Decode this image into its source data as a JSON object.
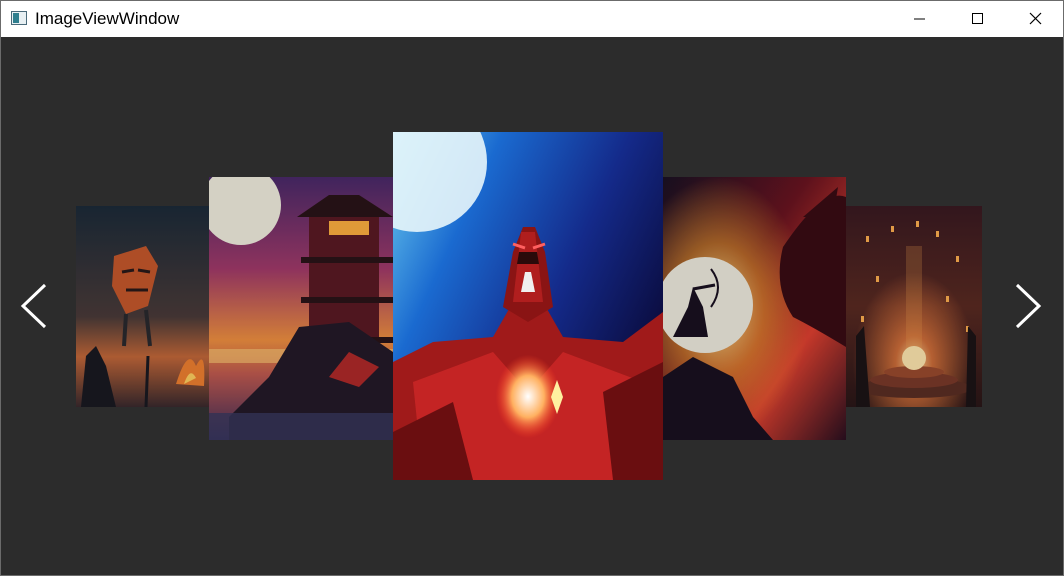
{
  "window": {
    "title": "ImageViewWindow",
    "buttons": {
      "minimize": "minimize-icon",
      "maximize": "maximize-icon",
      "close": "close-icon"
    }
  },
  "carousel": {
    "background": "#2c2c2c",
    "nav_prev_icon": "chevron-left-icon",
    "nav_next_icon": "chevron-right-icon",
    "images": [
      {
        "name": "campfire-mask-art"
      },
      {
        "name": "pagoda-sunset-art"
      },
      {
        "name": "red-robot-hero-art"
      },
      {
        "name": "archer-dragon-art"
      },
      {
        "name": "lantern-shrine-art"
      }
    ]
  }
}
